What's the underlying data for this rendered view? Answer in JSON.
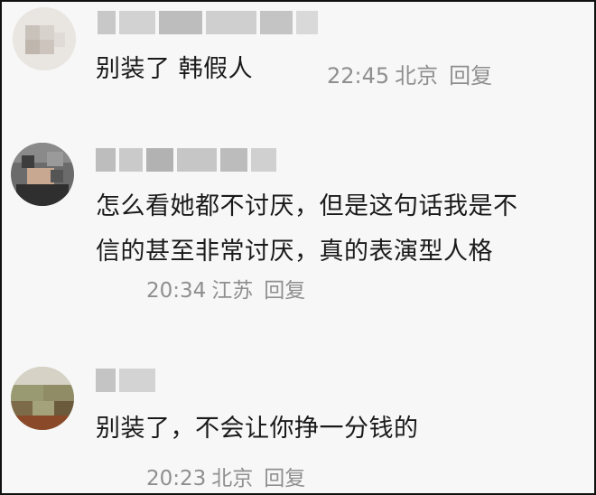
{
  "comments": [
    {
      "text_lines": [
        "别装了 韩假人"
      ],
      "time": "22:45",
      "location": "北京",
      "reply_label": "回复"
    },
    {
      "text_lines": [
        "怎么看她都不讨厌，但是这句话我是不",
        "信的甚至非常讨厌，真的表演型人格"
      ],
      "time": "20:34",
      "location": "江苏",
      "reply_label": "回复"
    },
    {
      "text_lines": [
        "别装了，不会让你挣一分钱的"
      ],
      "time": "20:23",
      "location": "北京",
      "reply_label": "回复"
    }
  ],
  "colors": {
    "text": "#1a1a1a",
    "meta": "#8f8f8f",
    "background": "#f7f7f7",
    "border": "#111111"
  }
}
